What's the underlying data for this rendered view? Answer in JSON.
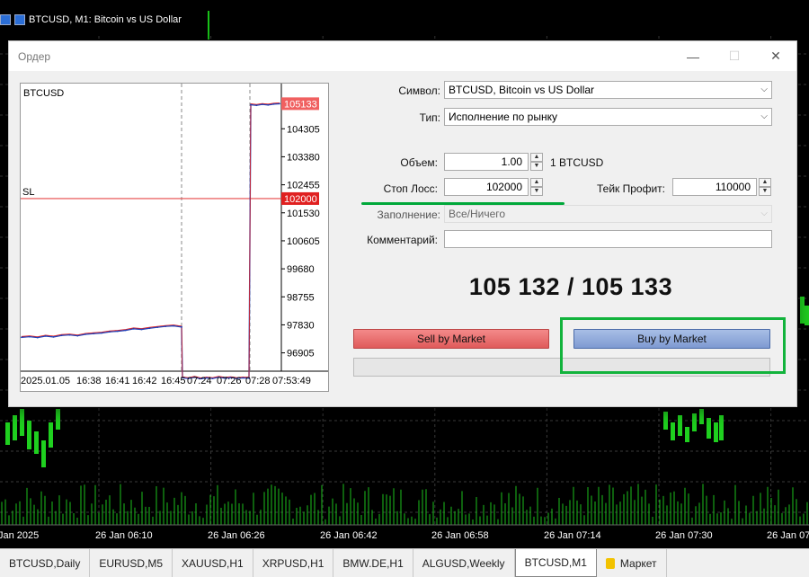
{
  "window": {
    "title": "BTCUSD, M1:  Bitcoin vs US Dollar"
  },
  "time_axis": {
    "labels": [
      "Jan 2025",
      "26 Jan 06:10",
      "26 Jan 06:26",
      "26 Jan 06:42",
      "26 Jan 06:58",
      "26 Jan 07:14",
      "26 Jan 07:30",
      "26 Jan 07"
    ]
  },
  "tabs": [
    {
      "label": "BTCUSD,Daily",
      "active": false
    },
    {
      "label": "EURUSD,M5",
      "active": false
    },
    {
      "label": "XAUUSD,H1",
      "active": false
    },
    {
      "label": "XRPUSD,H1",
      "active": false
    },
    {
      "label": "BMW.DE,H1",
      "active": false
    },
    {
      "label": "ALGUSD,Weekly",
      "active": false
    },
    {
      "label": "BTCUSD,M1",
      "active": true
    },
    {
      "label": "Маркет",
      "active": false,
      "icon": "lock-icon"
    }
  ],
  "dialog": {
    "title": "Ордер",
    "controls": {
      "minimize": "—",
      "maximize": "☐",
      "close": "✕"
    },
    "form": {
      "symbol_label": "Символ:",
      "symbol_value": "BTCUSD, Bitcoin vs US Dollar",
      "type_label": "Тип:",
      "type_value": "Исполнение по рынку",
      "volume_label": "Объем:",
      "volume_value": "1.00",
      "volume_unit": "1 BTCUSD",
      "sl_label": "Стоп Лосс:",
      "sl_value": "102000",
      "tp_label": "Тейк Профит:",
      "tp_value": "110000",
      "fill_label": "Заполнение:",
      "fill_value": "Все/Ничего",
      "comment_label": "Комментарий:",
      "comment_value": ""
    },
    "price_text": "105 132 / 105 133",
    "sell_label": "Sell by Market",
    "buy_label": "Buy by Market",
    "colors": {
      "sell": "#e86a6a",
      "buy": "#8aa4d8",
      "highlight": "#12b33c",
      "sl_line": "#e84848"
    }
  },
  "chart_data": {
    "type": "line",
    "symbol_label": "BTCUSD",
    "sl_label": "SL",
    "sl_price": 102000,
    "current_price": 105133,
    "y_ticks": [
      104305,
      103380,
      102455,
      101530,
      100605,
      99680,
      98755,
      97830,
      96905
    ],
    "ylim": [
      96300,
      105500
    ],
    "x_labels": [
      "2025.01.05",
      "16:38",
      "16:41",
      "16:42",
      "16:45",
      "07:24",
      "07:26",
      "07:28",
      "07:53:49"
    ],
    "series": [
      {
        "values": [
          97420,
          97440,
          97410,
          97460,
          97430,
          97480,
          97500,
          97470,
          97520,
          97540,
          97560,
          97600,
          97620,
          97650,
          97700,
          97680,
          97720,
          97750,
          97780,
          97800,
          97760,
          96080,
          96060,
          96100,
          96050,
          96080,
          96060,
          96100,
          96070,
          96090,
          96060,
          96080,
          96070,
          105100,
          105080,
          105110,
          105090,
          105120,
          105133
        ]
      }
    ]
  }
}
